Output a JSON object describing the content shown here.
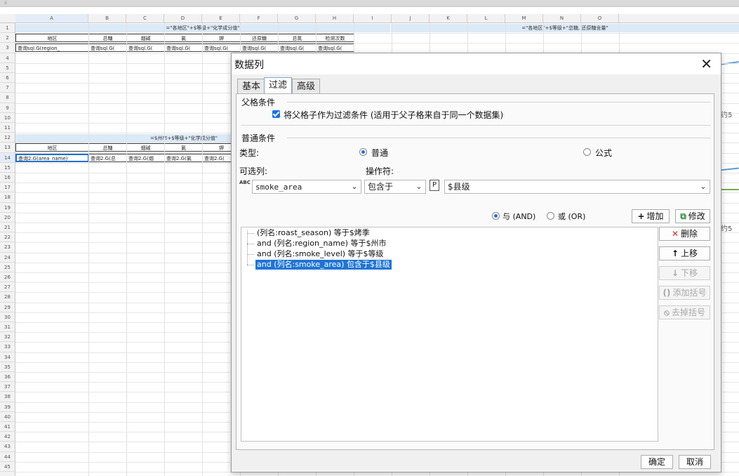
{
  "sheet": {
    "columns": [
      "A",
      "B",
      "C",
      "D",
      "E",
      "F",
      "G",
      "H",
      "I",
      "J",
      "K",
      "L",
      "M",
      "N",
      "O"
    ],
    "rows": [
      "1",
      "2",
      "3",
      "4",
      "5",
      "6",
      "7",
      "8",
      "9",
      "10",
      "11",
      "12",
      "13",
      "14",
      "15",
      "16",
      "17",
      "18",
      "19",
      "20",
      "21",
      "22",
      "23",
      "24",
      "25",
      "26",
      "27",
      "28",
      "29",
      "30",
      "31",
      "32",
      "33",
      "34",
      "35",
      "36",
      "37",
      "38",
      "39",
      "40",
      "41",
      "42",
      "43",
      "44",
      "45"
    ],
    "band1_left": "=\"各地区\"+$等级+\"化学成分值\"",
    "band1_right": "=\"各地区\"+$等级+\"总糖, 还原糖含量\"",
    "band2": "=$州市+$等级+\"化学成分值\"",
    "table1_headers": [
      "地区",
      "总糖",
      "烟碱",
      "氯",
      "钾",
      "还原糖",
      "总氮",
      "检测次数"
    ],
    "table1_values": [
      "查询sql.G(region_",
      "查询sql.G(",
      "查询sql.G(",
      "查询sql.G(",
      "查询sql.G(",
      "查询sql.G(",
      "查询sql.G(",
      "查询sql.G("
    ],
    "table2_headers": [
      "地区",
      "总糖",
      "烟碱",
      "氯",
      "钾"
    ],
    "table2_values": [
      "查询2.G(area_name)",
      "查询2.G(总",
      "查询2.G(烟",
      "查询2.G(氯",
      "查询2.G("
    ],
    "side_text1": "约5",
    "side_text2": "约5",
    "line_colors": {
      "blue": "#5b9bd5",
      "green": "#70ad47"
    }
  },
  "dialog": {
    "title": "数据列",
    "close_icon": "close-icon",
    "tabs": [
      {
        "label": "基本",
        "active": false
      },
      {
        "label": "过滤",
        "active": true
      },
      {
        "label": "高级",
        "active": false
      }
    ],
    "parent": {
      "title": "父格条件",
      "checkbox_label": "将父格子作为过滤条件 (适用于父子格来自于同一个数据集)",
      "checked": true
    },
    "normal": {
      "title": "普通条件",
      "type_label": "类型:",
      "radio_normal": "普通",
      "radio_formula": "公式",
      "column_label": "可选列:",
      "operator_label": "操作符:",
      "column_value": "smoke_area",
      "column_icon_text": "ABC",
      "operator_value": "包含于",
      "param_badge": "P",
      "param_value": "$县级",
      "and_label": "与 (AND)",
      "or_label": "或 (OR)",
      "add_button": "增加",
      "modify_button": "修改"
    },
    "conditions": [
      "(列名:roast_season) 等于$烤季",
      "and (列名:region_name) 等于$州市",
      "and (列名:smoke_level) 等于$等级",
      "and (列名:smoke_area) 包含于$县级"
    ],
    "selected_index": 3,
    "side_buttons": {
      "delete": "删除",
      "up": "上移",
      "down": "下移",
      "add_paren": "添加括号",
      "remove_paren": "去掉括号"
    },
    "footer": {
      "ok": "确定",
      "cancel": "取消"
    },
    "accent_color": "#1a73e8"
  }
}
